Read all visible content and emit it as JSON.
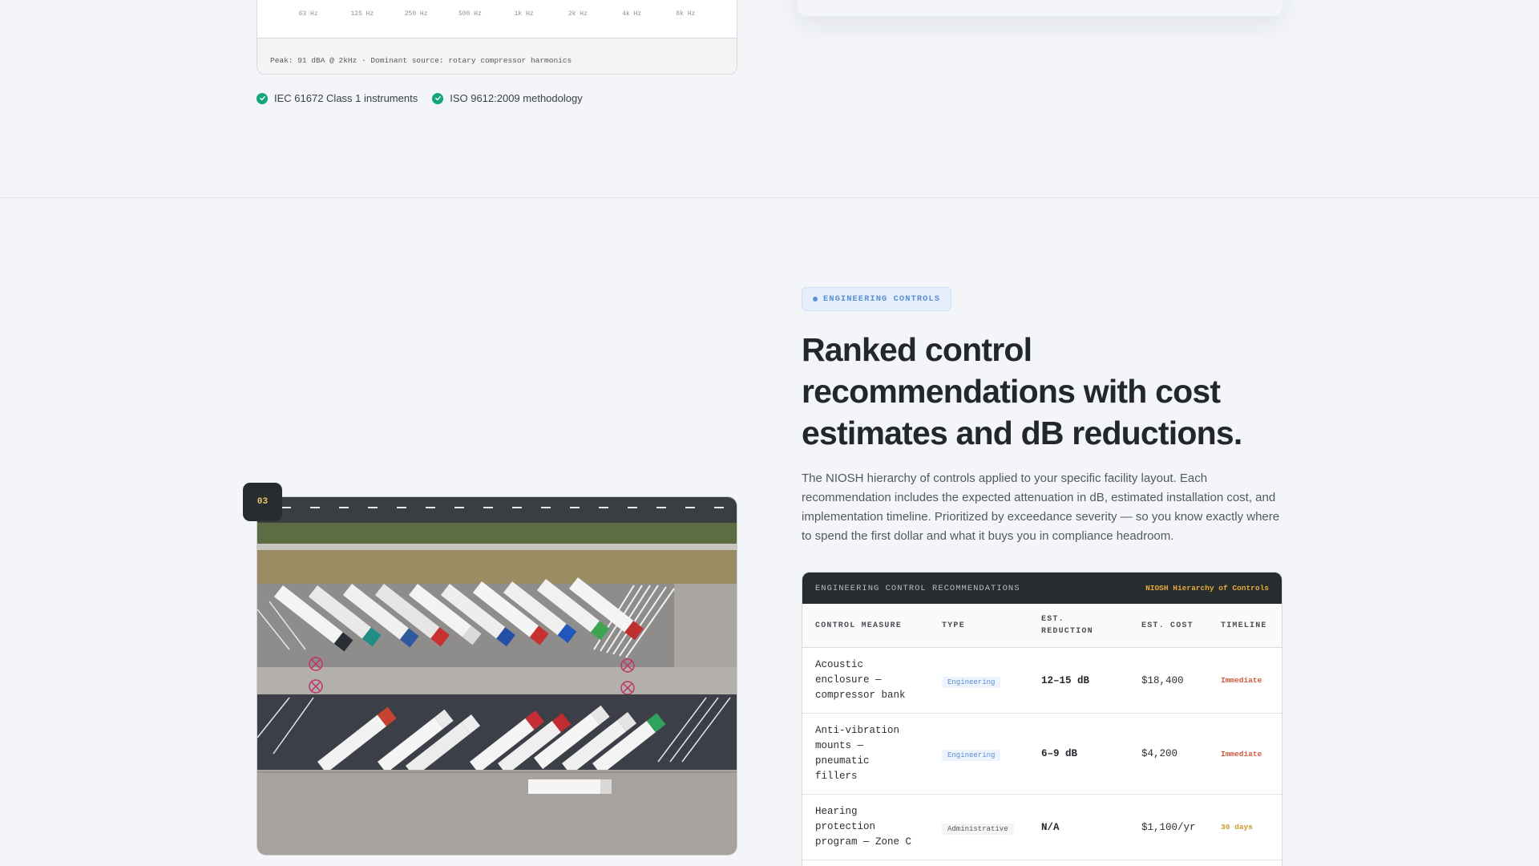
{
  "spectrum": {
    "frequencies": [
      "63 Hz",
      "125 Hz",
      "250 Hz",
      "500 Hz",
      "1k Hz",
      "2k Hz",
      "4k Hz",
      "8k Hz"
    ],
    "footer": "Peak: 91 dBA @ 2kHz · Dominant source: rotary compressor harmonics"
  },
  "certifications": [
    {
      "label": "IEC 61672 Class 1 instruments",
      "icon": "check-circle-icon"
    },
    {
      "label": "ISO 9612:2009 methodology",
      "icon": "check-circle-icon"
    }
  ],
  "section": {
    "tag": "ENGINEERING CONTROLS",
    "headline": "Ranked control recommendations with cost estimates and dB reductions.",
    "description": "The NIOSH hierarchy of controls applied to your specific facility layout. Each recommendation includes the expected attenuation in dB, estimated installation cost, and implementation timeline. Prioritized by exceedance severity — so you know exactly where to spend the first dollar and what it buys you in compliance headroom.",
    "step_number": "03"
  },
  "table": {
    "title": "ENGINEERING CONTROL RECOMMENDATIONS",
    "subtitle": "NIOSH Hierarchy of Controls",
    "columns": [
      "CONTROL MEASURE",
      "TYPE",
      "EST. REDUCTION",
      "EST. COST",
      "TIMELINE"
    ],
    "rows": [
      {
        "measure": "Acoustic enclosure — compressor bank",
        "type": "Engineering",
        "reduction": "12–15 dB",
        "cost": "$18,400",
        "timeline": "Immediate"
      },
      {
        "measure": "Anti-vibration mounts — pneumatic fillers",
        "type": "Engineering",
        "reduction": "6–9 dB",
        "cost": "$4,200",
        "timeline": "Immediate"
      },
      {
        "measure": "Hearing protection program — Zone C",
        "type": "Administrative",
        "reduction": "N/A",
        "cost": "$1,100/yr",
        "timeline": "30 days"
      }
    ]
  },
  "colors": {
    "accent_blue": "#5b8fd3",
    "check_green": "#13a57d",
    "immediate_red": "#d2563c",
    "thirty_days_amber": "#c89a2c",
    "dark_header": "#272d2e"
  }
}
